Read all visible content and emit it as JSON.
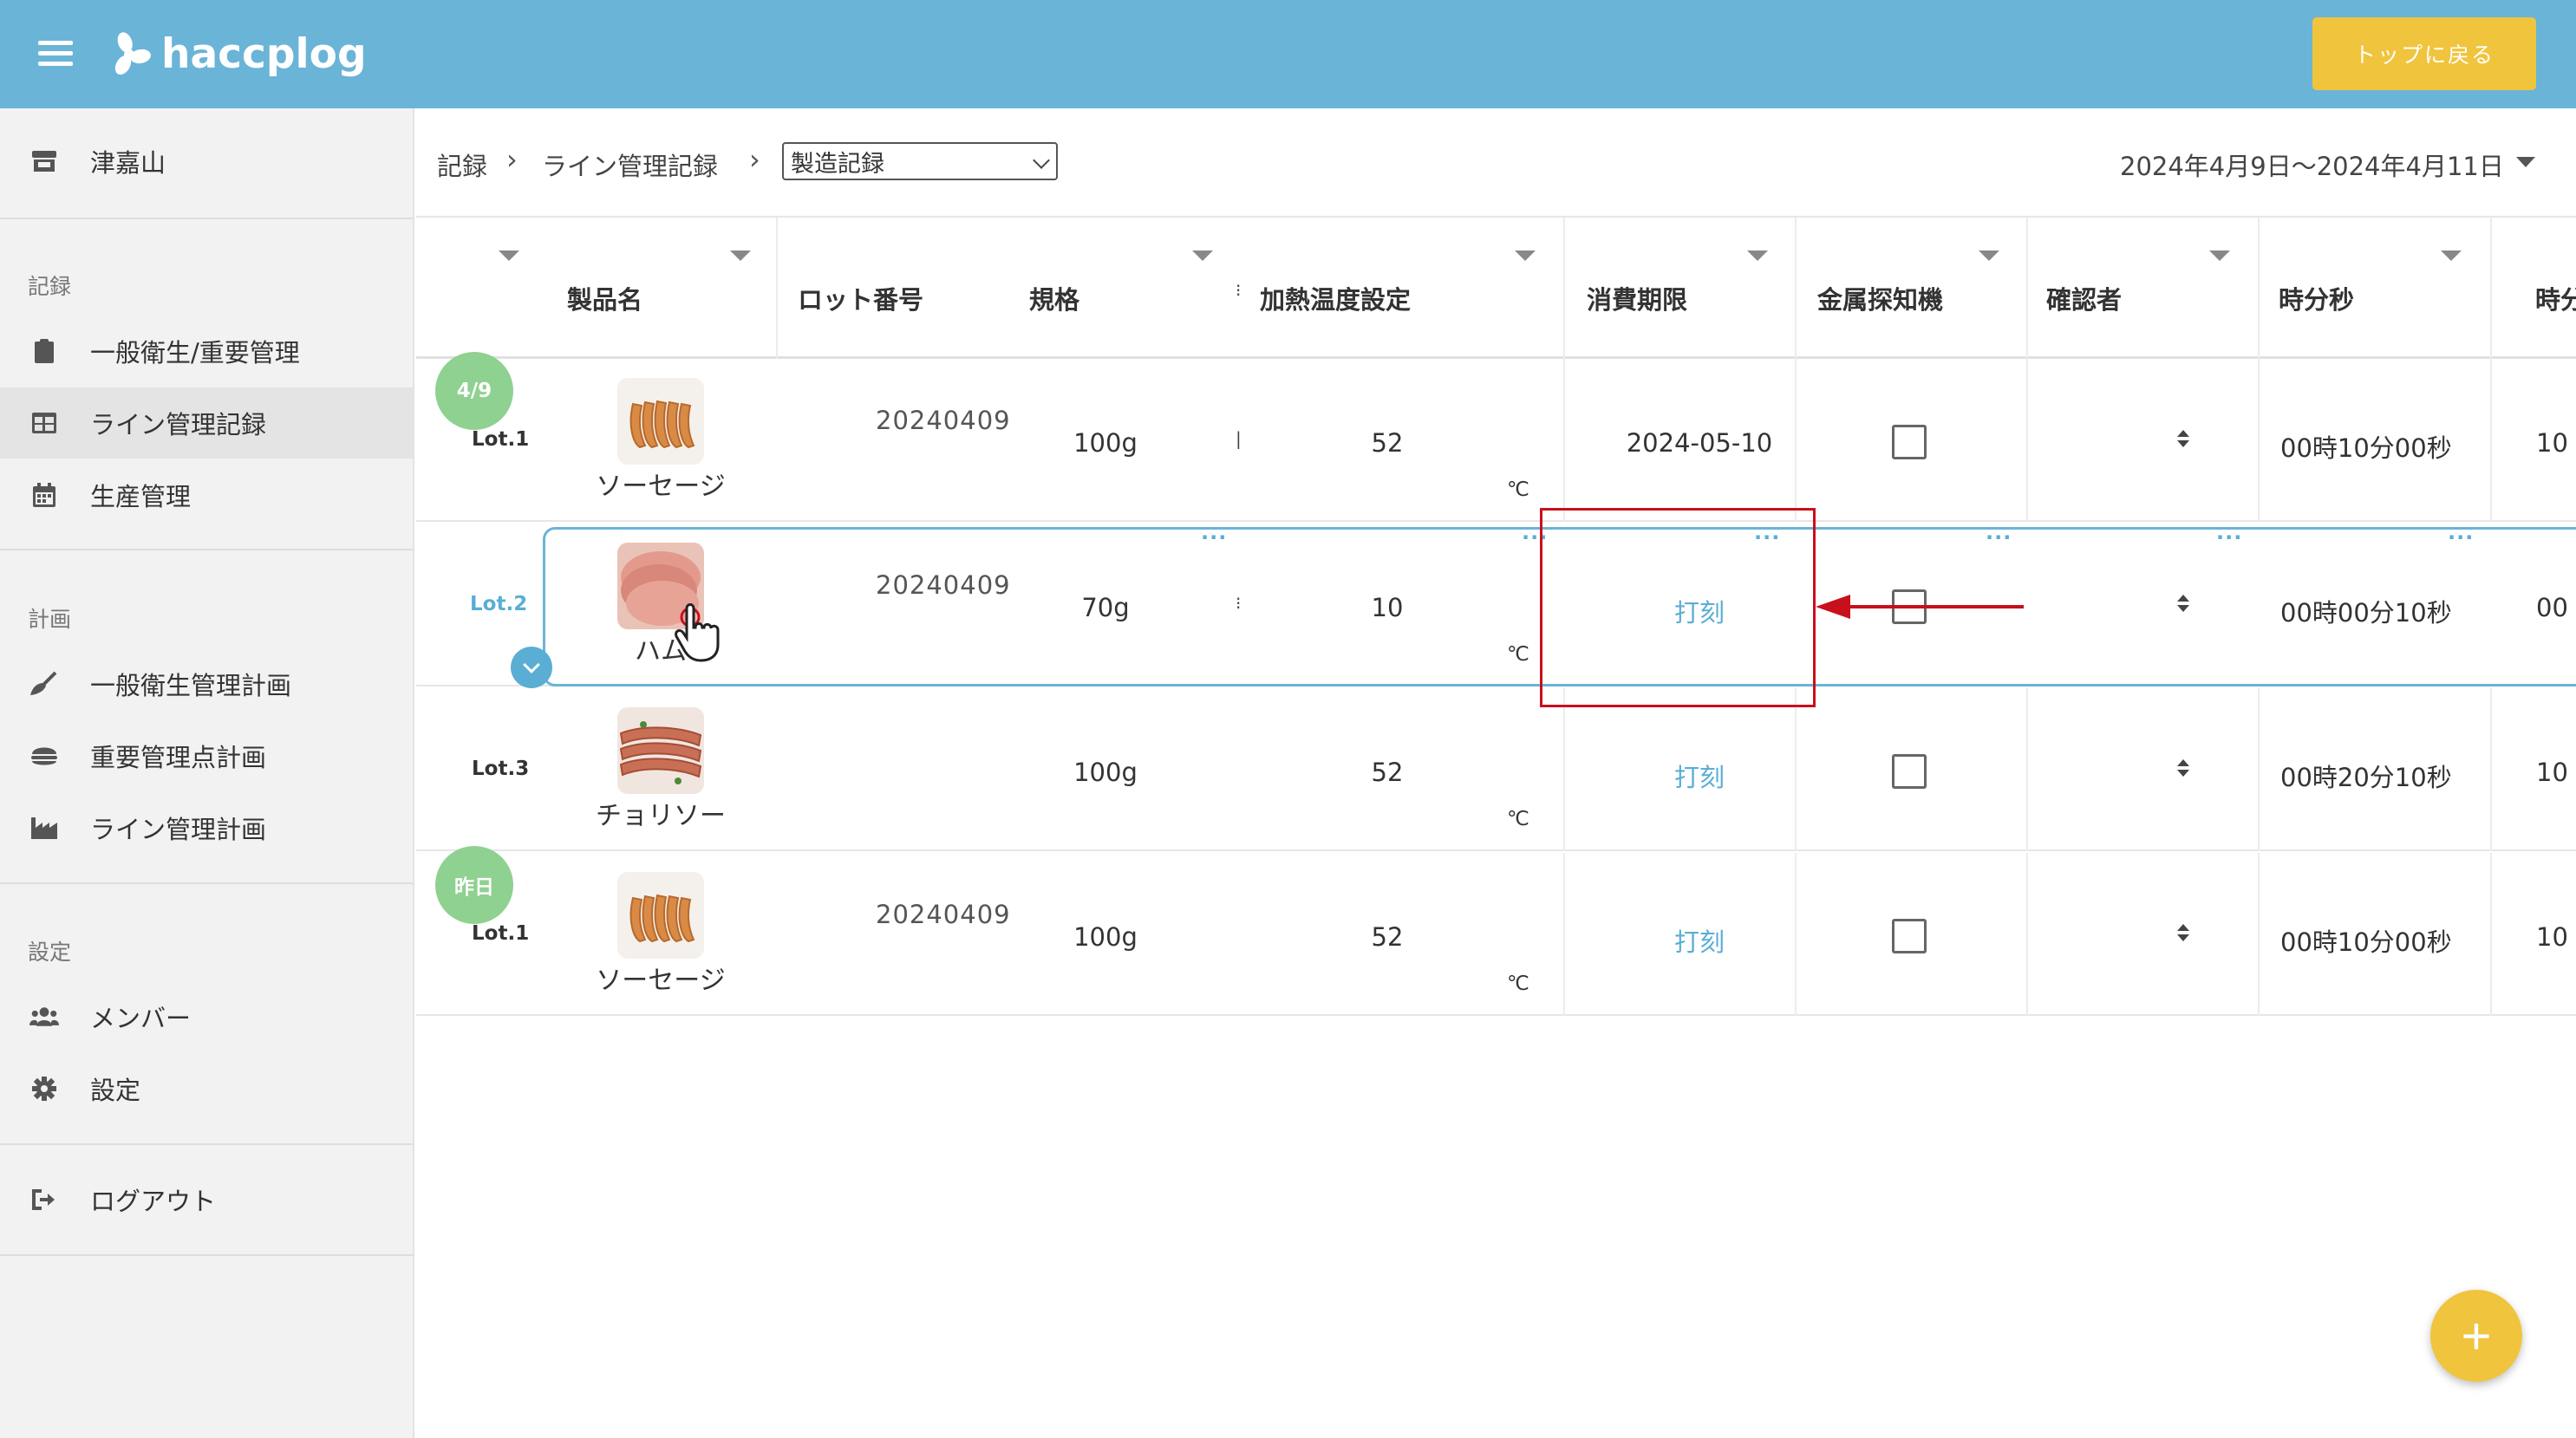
{
  "header": {
    "logo_text": "haccplog",
    "top_button_label": "トップに戻る"
  },
  "sidebar": {
    "store_name": "津嘉山",
    "sections": {
      "records": "記録",
      "plans": "計画",
      "settings": "設定"
    },
    "items": {
      "general_hygiene": "一般衛生/重要管理",
      "line_records": "ライン管理記録",
      "production": "生産管理",
      "general_plan": "一般衛生管理計画",
      "ccp_plan": "重要管理点計画",
      "line_plan": "ライン管理計画",
      "members": "メンバー",
      "settings": "設定",
      "logout": "ログアウト"
    }
  },
  "breadcrumb": {
    "level1": "記録",
    "level2": "ライン管理記録",
    "select_value": "製造記録",
    "date_range": "2024年4月9日〜2024年4月11日"
  },
  "table": {
    "columns": {
      "product": "製品名",
      "lot_number": "ロット番号",
      "spec": "規格",
      "heat_temp": "加熱温度設定",
      "expiry": "消費期限",
      "metal_detector": "金属探知機",
      "checker": "確認者",
      "hms": "時分秒",
      "hms2": "時分"
    },
    "unit": "℃",
    "rows": [
      {
        "badge": "4/9",
        "lot": "Lot.1",
        "product": "ソーセージ",
        "lot_number": "20240409",
        "spec": "100g",
        "temp": "52",
        "expiry": "2024-05-10",
        "hms": "00時10分00秒",
        "hms2": "10"
      },
      {
        "badge": "",
        "lot": "Lot.2",
        "product": "ハム",
        "lot_number": "20240409",
        "spec": "70g",
        "temp": "10",
        "expiry": "打刻",
        "hms": "00時00分10秒",
        "hms2": "00"
      },
      {
        "badge": "",
        "lot": "Lot.3",
        "product": "チョリソー",
        "lot_number": "",
        "spec": "100g",
        "temp": "52",
        "expiry": "打刻",
        "hms": "00時20分10秒",
        "hms2": "10"
      },
      {
        "badge": "昨日",
        "lot": "Lot.1",
        "product": "ソーセージ",
        "lot_number": "20240409",
        "spec": "100g",
        "temp": "52",
        "expiry": "打刻",
        "hms": "00時10分00秒",
        "hms2": "10"
      }
    ]
  },
  "colors": {
    "header": "#6ab4d7",
    "accent_yellow": "#f0c43d",
    "badge_green": "#8fd190",
    "link_blue": "#5aaed4",
    "annotation_red": "#c8101d"
  },
  "fab_label": "+"
}
